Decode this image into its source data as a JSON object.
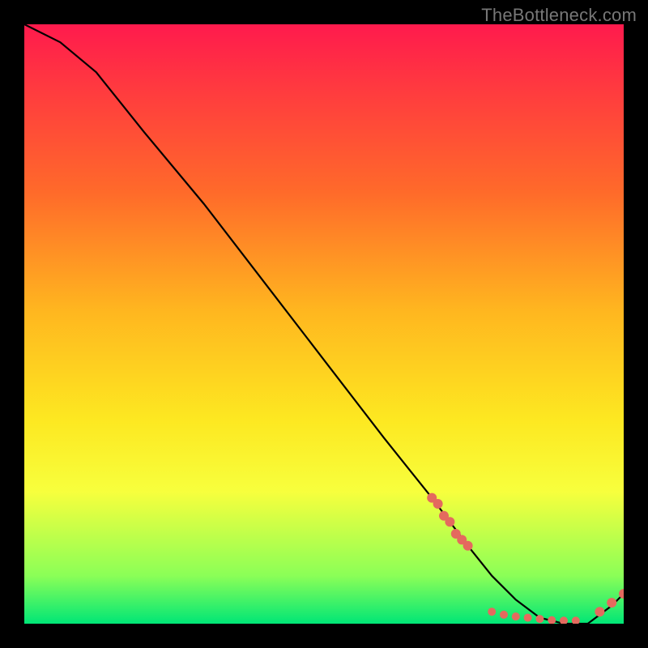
{
  "watermark": "TheBottleneck.com",
  "chart_data": {
    "type": "line",
    "title": "",
    "xlabel": "",
    "ylabel": "",
    "xlim": [
      0,
      100
    ],
    "ylim": [
      0,
      100
    ],
    "series": [
      {
        "name": "curve",
        "x": [
          0,
          6,
          12,
          20,
          30,
          40,
          50,
          60,
          68,
          74,
          78,
          82,
          86,
          90,
          94,
          98,
          100
        ],
        "values": [
          100,
          97,
          92,
          82,
          70,
          57,
          44,
          31,
          21,
          13,
          8,
          4,
          1,
          0,
          0,
          3,
          5
        ]
      }
    ],
    "points_left_cluster": {
      "x": [
        68,
        69,
        70,
        71,
        72,
        73,
        74
      ],
      "y": [
        21,
        20,
        18,
        17,
        15,
        14,
        13
      ]
    },
    "points_bottom_cluster": {
      "x": [
        78,
        80,
        82,
        84,
        86,
        88,
        90,
        92
      ],
      "y": [
        2,
        1.5,
        1.2,
        1,
        0.8,
        0.6,
        0.5,
        0.5
      ]
    },
    "points_right_cluster": {
      "x": [
        96,
        98,
        100
      ],
      "y": [
        2,
        3.5,
        5
      ]
    }
  }
}
